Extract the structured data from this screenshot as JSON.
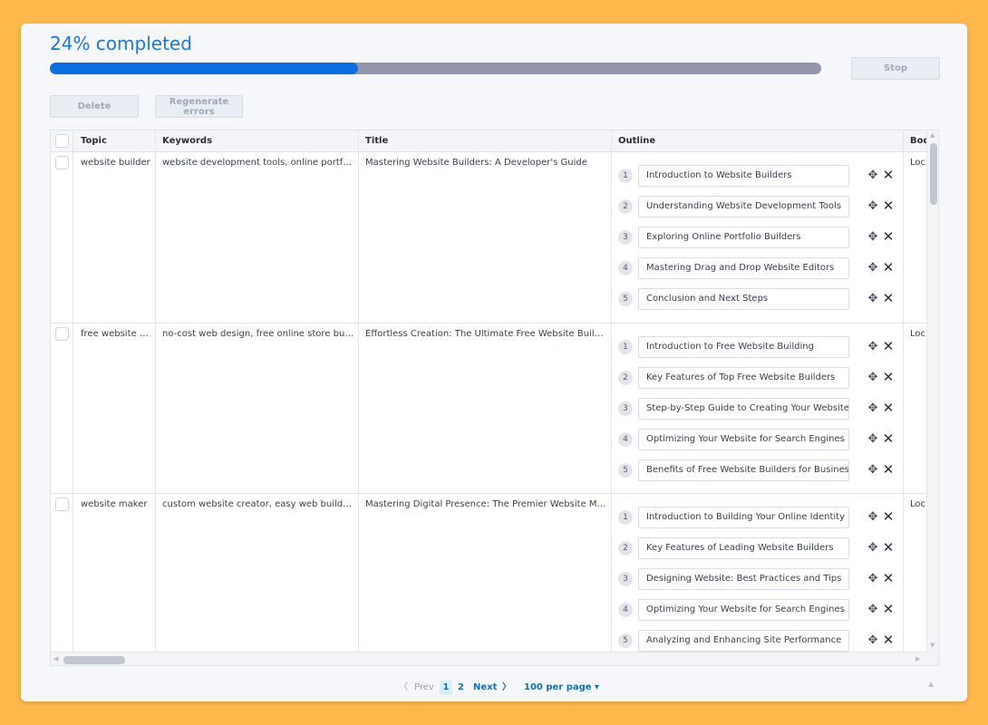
{
  "progress": {
    "label": "24% completed",
    "fraction": 0.4
  },
  "buttons": {
    "stop": "Stop",
    "delete": "Delete",
    "regenerate": "Regenerate errors"
  },
  "table": {
    "columns": [
      "Topic",
      "Keywords",
      "Title",
      "Outline",
      "Bod"
    ],
    "rows": [
      {
        "topic": "website builder",
        "keywords": "website development tools, online portfolio builders",
        "title": "Mastering Website Builders: A Developer's Guide",
        "body": "Loc",
        "outline": [
          "Introduction to Website Builders",
          "Understanding Website Development Tools",
          "Exploring Online Portfolio Builders",
          "Mastering Drag and Drop Website Editors",
          "Conclusion and Next Steps"
        ]
      },
      {
        "topic": "free website builder",
        "keywords": "no-cost web design, free online store builder",
        "title": "Effortless Creation: The Ultimate Free Website Builder",
        "body": "Loc",
        "outline": [
          "Introduction to Free Website Building",
          "Key Features of Top Free Website Builders",
          "Step-by-Step Guide to Creating Your Website",
          "Optimizing Your Website for Search Engines",
          "Benefits of Free Website Builders for Business"
        ]
      },
      {
        "topic": "website maker",
        "keywords": "custom website creator, easy web builder, site maker",
        "title": "Mastering Digital Presence: The Premier Website Maker",
        "body": "Loc",
        "outline": [
          "Introduction to Building Your Online Identity",
          "Key Features of Leading Website Builders",
          "Designing Website: Best Practices and Tips",
          "Optimizing Your Website for Search Engines",
          "Analyzing and Enhancing Site Performance"
        ]
      }
    ]
  },
  "pagination": {
    "prev": "Prev",
    "pages": [
      "1",
      "2"
    ],
    "next": "Next",
    "per_page": "100 per page"
  }
}
